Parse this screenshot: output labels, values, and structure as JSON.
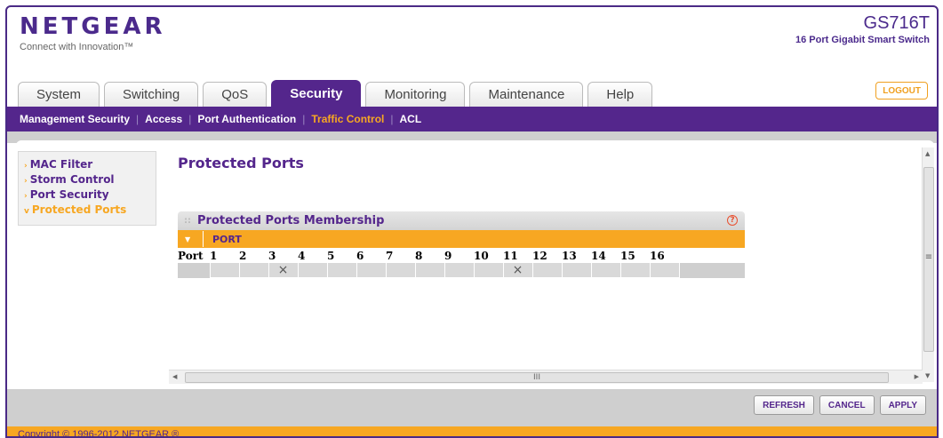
{
  "brand": {
    "logo": "NETGEAR",
    "tagline": "Connect with Innovation™"
  },
  "model": {
    "name": "GS716T",
    "description": "16 Port Gigabit Smart Switch"
  },
  "tabs": [
    {
      "label": "System"
    },
    {
      "label": "Switching"
    },
    {
      "label": "QoS"
    },
    {
      "label": "Security",
      "active": true
    },
    {
      "label": "Monitoring"
    },
    {
      "label": "Maintenance"
    },
    {
      "label": "Help"
    }
  ],
  "logout_label": "LOGOUT",
  "subnav": [
    {
      "label": "Management Security"
    },
    {
      "label": "Access"
    },
    {
      "label": "Port Authentication"
    },
    {
      "label": "Traffic Control",
      "active": true
    },
    {
      "label": "ACL"
    }
  ],
  "leftnav": [
    {
      "label": "MAC Filter"
    },
    {
      "label": "Storm Control"
    },
    {
      "label": "Port Security"
    },
    {
      "label": "Protected Ports",
      "active": true
    }
  ],
  "page_title": "Protected Ports",
  "panel": {
    "title": "Protected Ports Membership",
    "help_icon": "?",
    "port_bar_label": "PORT",
    "port_header": "Port",
    "ports": [
      "1",
      "2",
      "3",
      "4",
      "5",
      "6",
      "7",
      "8",
      "9",
      "10",
      "11",
      "12",
      "13",
      "14",
      "15",
      "16"
    ],
    "marks": [
      "",
      "",
      "×",
      "",
      "",
      "",
      "",
      "",
      "",
      "",
      "×",
      "",
      "",
      "",
      "",
      ""
    ]
  },
  "scroll": {
    "v_grip": "≡",
    "h_grip": "III"
  },
  "buttons": {
    "refresh": "REFRESH",
    "cancel": "CANCEL",
    "apply": "APPLY"
  },
  "footer": "Copyright © 1996-2012 NETGEAR ®",
  "colors": {
    "brand_purple": "#54268c",
    "accent_orange": "#f7a722"
  }
}
